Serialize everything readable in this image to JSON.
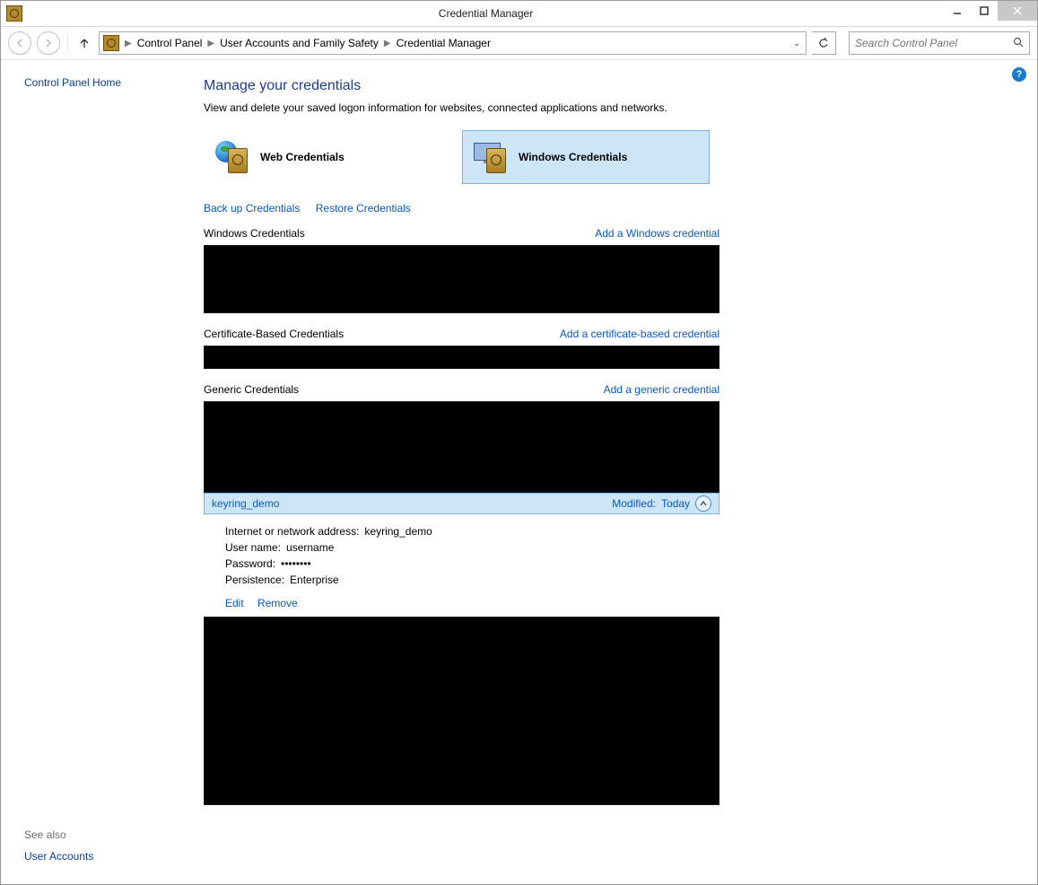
{
  "window": {
    "title": "Credential Manager"
  },
  "breadcrumb": {
    "items": [
      "Control Panel",
      "User Accounts and Family Safety",
      "Credential Manager"
    ]
  },
  "search": {
    "placeholder": "Search Control Panel"
  },
  "sidebar": {
    "home": "Control Panel Home",
    "see_also": "See also",
    "user_accounts": "User Accounts"
  },
  "page": {
    "title": "Manage your credentials",
    "subtitle": "View and delete your saved logon information for websites, connected applications and networks."
  },
  "tiles": {
    "web": "Web Credentials",
    "windows": "Windows Credentials"
  },
  "links": {
    "backup": "Back up Credentials",
    "restore": "Restore Credentials"
  },
  "sections": {
    "windows": {
      "label": "Windows Credentials",
      "add": "Add a Windows credential"
    },
    "cert": {
      "label": "Certificate-Based Credentials",
      "add": "Add a certificate-based credential"
    },
    "generic": {
      "label": "Generic Credentials",
      "add": "Add a generic credential"
    }
  },
  "entry": {
    "name": "keyring_demo",
    "modified_label": "Modified:",
    "modified_value": "Today",
    "addr_label": "Internet or network address:",
    "addr_value": "keyring_demo",
    "user_label": "User name:",
    "user_value": "username",
    "pass_label": "Password:",
    "pass_value": "••••••••",
    "persist_label": "Persistence:",
    "persist_value": "Enterprise",
    "edit": "Edit",
    "remove": "Remove"
  }
}
